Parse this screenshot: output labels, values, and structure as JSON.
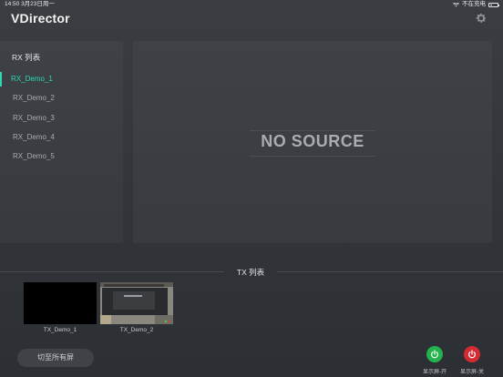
{
  "status_bar": {
    "time_date": "14:50  3月23日周一",
    "charging": "不在充电"
  },
  "app": {
    "logo": "VDirector"
  },
  "rx": {
    "title": "RX 列表",
    "items": [
      {
        "label": "RX_Demo_1",
        "selected": true
      },
      {
        "label": "RX_Demo_2",
        "selected": false
      },
      {
        "label": "RX_Demo_3",
        "selected": false
      },
      {
        "label": "RX_Demo_4",
        "selected": false
      },
      {
        "label": "RX_Demo_5",
        "selected": false
      }
    ]
  },
  "preview": {
    "no_source": "NO SOURCE"
  },
  "tx": {
    "title": "TX 列表",
    "items": [
      {
        "label": "TX_Demo_1",
        "thumbnail": "black"
      },
      {
        "label": "TX_Demo_2",
        "thumbnail": "camera"
      }
    ]
  },
  "footer": {
    "switch_all": "切至所有屏",
    "display_on": "显示屏-开",
    "display_off": "显示屏-关"
  },
  "colors": {
    "accent": "#2ed8b0",
    "on": "#24b24d",
    "off": "#d42b33"
  }
}
